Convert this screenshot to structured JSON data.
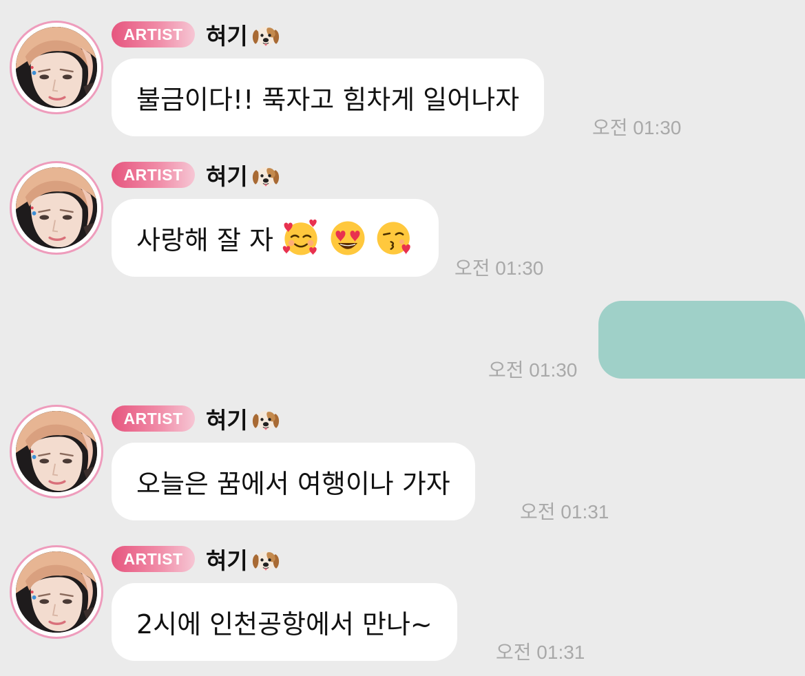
{
  "messages": [
    {
      "badge": "ARTIST",
      "sender": "혀기",
      "sender_icon": "dog-face",
      "text": "불금이다!! 푹자고 힘차게 일어나자",
      "emojis": [],
      "time": "오전 01:30"
    },
    {
      "badge": "ARTIST",
      "sender": "혀기",
      "sender_icon": "dog-face",
      "text": "사랑해 잘 자",
      "emojis": [
        "smiling-face-with-hearts",
        "heart-eyes-face",
        "face-blowing-kiss"
      ],
      "time": "오전 01:30"
    },
    {
      "badge": "ARTIST",
      "sender": "혀기",
      "sender_icon": "dog-face",
      "text": "오늘은 꿈에서 여행이나 가자",
      "emojis": [],
      "time": "오전 01:31"
    },
    {
      "badge": "ARTIST",
      "sender": "혀기",
      "sender_icon": "dog-face",
      "text": "2시에 인천공항에서 만나~",
      "emojis": [],
      "time": "오전 01:31"
    }
  ],
  "my_message": {
    "time": "오전 01:30",
    "bubble_color": "#9fd0c8"
  },
  "colors": {
    "background": "#ebebeb",
    "badge": "#e6567f",
    "avatar_ring": "#ee9cbc",
    "time_text": "#a9a9a9"
  }
}
